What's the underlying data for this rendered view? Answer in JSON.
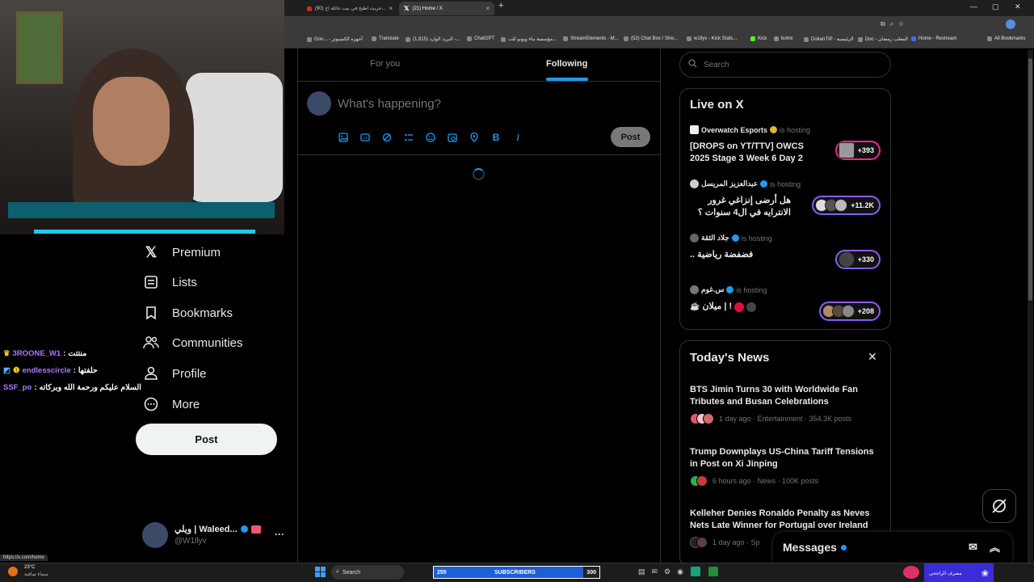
{
  "browser": {
    "tabs": [
      {
        "label": "(90) جربت اطبخ في بيت عائلة اخ...",
        "active": false
      },
      {
        "label": "(21) Home / X",
        "active": true
      }
    ],
    "bookmarks": [
      "Goo... - أجهزة الكمبيوتر",
      "Translate",
      "(1,815) البريد الوارد -...",
      "ChatGPT",
      "مؤسسة بناء ويونو للت...",
      "StreamElements - M...",
      "(52) Chat Box / Stre...",
      "w1llyv - Kick Stats...",
      "Kick",
      "botrix",
      "DokanTIP - الرئيسية",
      "Doc - المعلب رمضان",
      "Home - Restream",
      "All Bookmarks"
    ]
  },
  "nav": {
    "items": [
      {
        "label": "Premium",
        "icon": "x-logo-icon"
      },
      {
        "label": "Lists",
        "icon": "list-icon"
      },
      {
        "label": "Bookmarks",
        "icon": "bookmark-icon"
      },
      {
        "label": "Communities",
        "icon": "communities-icon"
      },
      {
        "label": "Profile",
        "icon": "person-icon"
      },
      {
        "label": "More",
        "icon": "more-circle-icon"
      }
    ],
    "post_label": "Post"
  },
  "account": {
    "name": "ويلي | Waleed...",
    "handle": "@W1llyv"
  },
  "chat": [
    {
      "user": "3ROONE_W1",
      "message": "منتتت"
    },
    {
      "user": "endlesscircle",
      "message": "حلفتها"
    },
    {
      "user": "SSF_po",
      "message": "السلام عليكم ورحمة الله وبركاته"
    }
  ],
  "timeline": {
    "tabs": [
      "For you",
      "Following"
    ],
    "active_tab": "Following",
    "composer_placeholder": "What's happening?",
    "post_label": "Post"
  },
  "sidebar": {
    "search_placeholder": "Search",
    "live": {
      "title": "Live on X",
      "items": [
        {
          "host": "Overwatch Esports",
          "status": "is hosting",
          "title": "[DROPS on YT/TTV] OWCS 2025 Stage 3 Week 6 Day 2",
          "count": "+393"
        },
        {
          "host": "عبدالعزيز المريسل",
          "status": "is hosting",
          "title": "هل أرضى إنزاغي غرور الانترايه في ال4 سنوات ؟",
          "count": "+11.2K"
        },
        {
          "host": "جلاد الثقة",
          "status": "is hosting",
          "title": "فضفضة رياضية ..",
          "count": "+330"
        },
        {
          "host": "س.غوم",
          "status": "is hosting",
          "title": "ميلان | !",
          "count": "+208"
        }
      ]
    },
    "news": {
      "title": "Today's News",
      "items": [
        {
          "headline": "BTS Jimin Turns 30 with Worldwide Fan Tributes and Busan Celebrations",
          "meta": "1 day ago · Entertainment · 354.3K posts"
        },
        {
          "headline": "Trump Downplays US-China Tariff Tensions in Post on Xi Jinping",
          "meta": "6 hours ago · News · 100K posts"
        },
        {
          "headline": "Kelleher Denies Ronaldo Penalty as Neves Nets Late Winner for Portugal over Ireland",
          "meta": "1 day ago · Sp"
        }
      ]
    }
  },
  "messages": {
    "label": "Messages"
  },
  "status_url": "https://x.com/home",
  "taskbar": {
    "search": "Search",
    "weather_temp": "23°C",
    "weather_desc": "سماء صافية",
    "subs_count": "255",
    "subs_label": "SUBSCRIBERS",
    "subs_goal": "300",
    "bank_label": "مصرف الراجحي"
  }
}
